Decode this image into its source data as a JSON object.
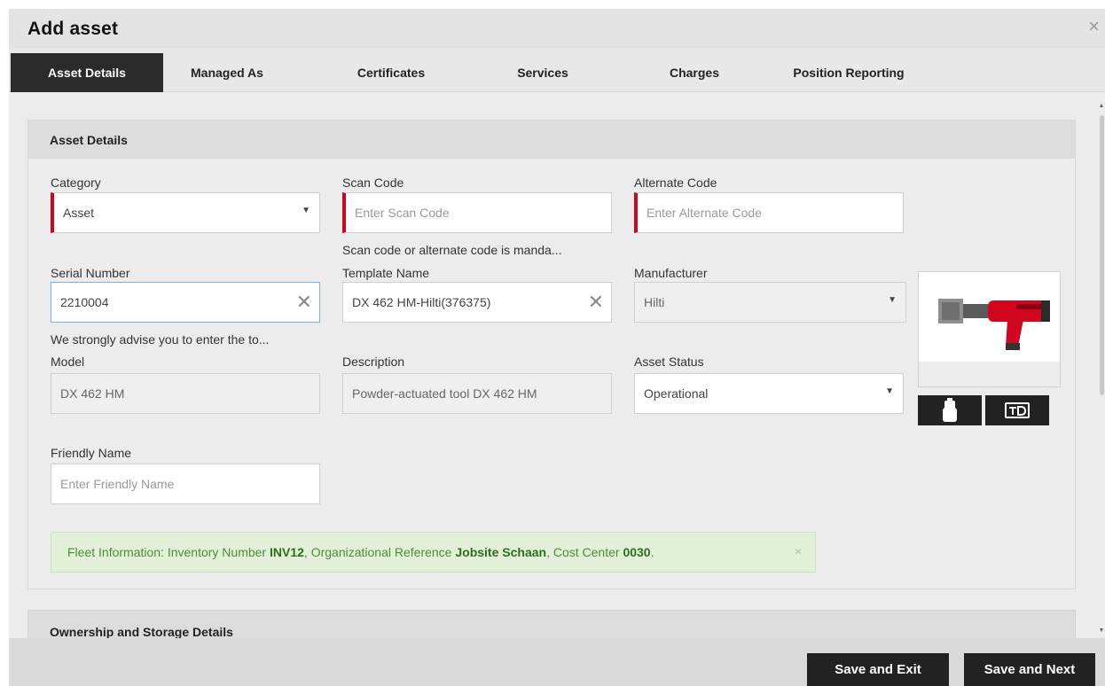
{
  "dialog": {
    "title": "Add asset",
    "close_glyph": "×"
  },
  "tabs": [
    {
      "label": "Asset Details",
      "active": true
    },
    {
      "label": "Managed As"
    },
    {
      "label": "Certificates"
    },
    {
      "label": "Services"
    },
    {
      "label": "Charges"
    },
    {
      "label": "Position Reporting"
    }
  ],
  "section": {
    "title": "Asset Details"
  },
  "form": {
    "category": {
      "label": "Category",
      "value": "Asset"
    },
    "scan_code": {
      "label": "Scan Code",
      "placeholder": "Enter Scan Code",
      "hint": "Scan code or alternate code is manda..."
    },
    "alternate_code": {
      "label": "Alternate Code",
      "placeholder": "Enter Alternate Code"
    },
    "serial_number": {
      "label": "Serial Number",
      "value": "2210004",
      "hint": "We strongly advise you to enter the to..."
    },
    "template_name": {
      "label": "Template Name",
      "value": "DX 462 HM-Hilti(376375)"
    },
    "manufacturer": {
      "label": "Manufacturer",
      "value": "Hilti"
    },
    "model": {
      "label": "Model",
      "value": "DX 462 HM"
    },
    "description": {
      "label": "Description",
      "value": "Powder-actuated tool DX 462 HM"
    },
    "asset_status": {
      "label": "Asset Status",
      "value": "Operational"
    },
    "friendly_name": {
      "label": "Friendly Name",
      "placeholder": "Enter Friendly Name"
    }
  },
  "icons": {
    "close": "close-icon",
    "dropdown": "caret-down-icon",
    "clear": "clear-icon",
    "upload": "upload-image-icon",
    "id_tag": "id-tag-icon",
    "product_image": "powder-actuated-tool-image"
  },
  "fleet": {
    "prefix": "Fleet Information: Inventory Number ",
    "inventory_number": "INV12",
    "org_prefix": ", Organizational Reference ",
    "org_reference": "Jobsite Schaan",
    "cost_prefix": ", Cost Center ",
    "cost_center": "0030",
    "suffix": ".",
    "close_glyph": "×"
  },
  "section2": {
    "title": "Ownership and Storage Details"
  },
  "footer": {
    "save_exit": "Save and Exit",
    "save_next": "Save and Next"
  },
  "colors": {
    "required_marker": "#d2051e",
    "active_tab": "#2b2b2b",
    "fleet_bg": "#e3f0d8",
    "fleet_text": "#4c8c3a",
    "product_red": "#d2051e"
  }
}
